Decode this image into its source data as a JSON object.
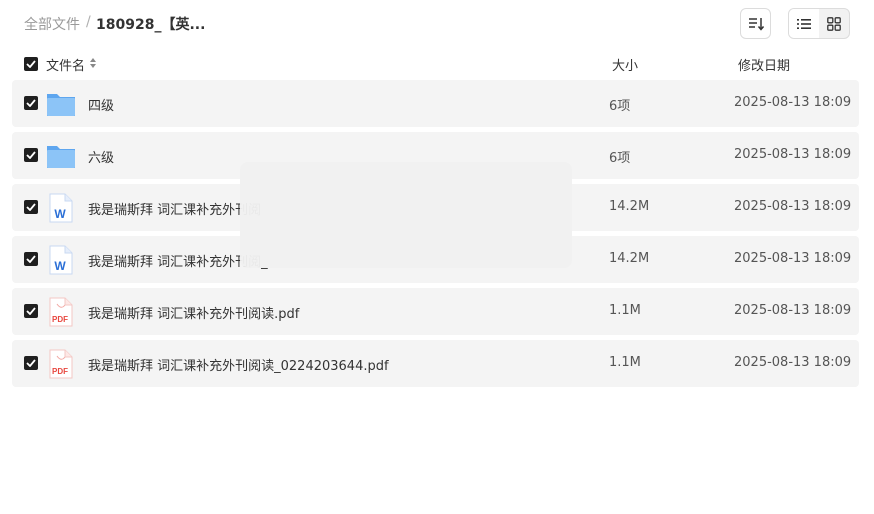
{
  "breadcrumb": {
    "root": "全部文件",
    "separator": "/",
    "current": "180928_【英..."
  },
  "toolbar": {
    "sort_icon": "sort-lines-icon",
    "list_view_icon": "list-view-icon",
    "grid_view_icon": "grid-view-icon",
    "active_view": "list"
  },
  "columns": {
    "name": "文件名",
    "size": "大小",
    "modified": "修改日期"
  },
  "files": [
    {
      "icon": "folder-icon",
      "name": "四级",
      "size": "6项",
      "modified": "2025-08-13 18:09",
      "checked": true
    },
    {
      "icon": "folder-icon",
      "name": "六级",
      "size": "6项",
      "modified": "2025-08-13 18:09",
      "checked": true
    },
    {
      "icon": "word-doc-icon",
      "name": "我是瑞斯拜 词汇课补充外刊阅",
      "size": "14.2M",
      "modified": "2025-08-13 18:09",
      "checked": true
    },
    {
      "icon": "word-doc-icon",
      "name": "我是瑞斯拜 词汇课补充外刊阅_",
      "size": "14.2M",
      "modified": "2025-08-13 18:09",
      "checked": true
    },
    {
      "icon": "pdf-icon",
      "name": "我是瑞斯拜 词汇课补充外刊阅读.pdf",
      "size": "1.1M",
      "modified": "2025-08-13 18:09",
      "checked": true
    },
    {
      "icon": "pdf-icon",
      "name": "我是瑞斯拜 词汇课补充外刊阅读_0224203644.pdf",
      "size": "1.1M",
      "modified": "2025-08-13 18:09",
      "checked": true
    }
  ],
  "icon_labels": {
    "word": "W",
    "pdf": "PDF"
  },
  "colors": {
    "folder": "#7ab8f5",
    "word": "#2b6fd6",
    "pdf": "#e8473f",
    "checkbox": "#1f1f1f",
    "row_bg": "#f4f4f4"
  }
}
